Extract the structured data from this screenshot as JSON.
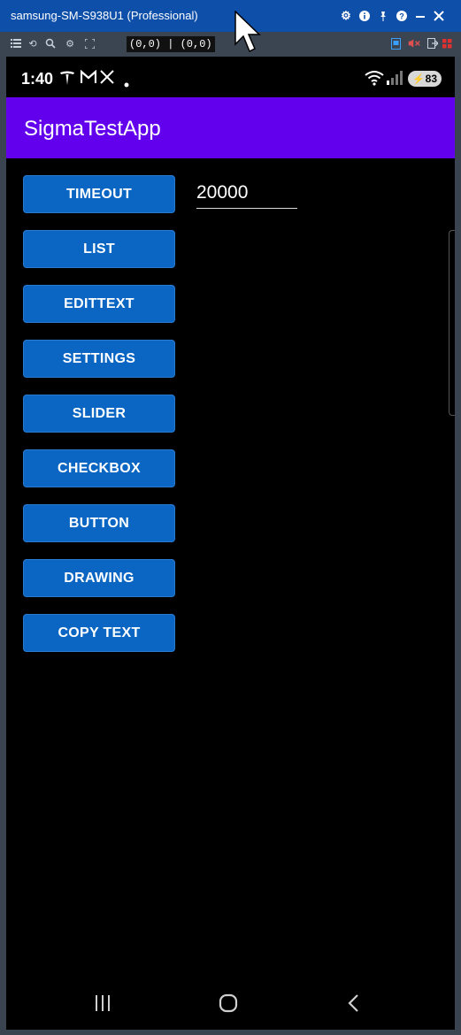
{
  "window": {
    "title": "samsung-SM-S938U1 (Professional)",
    "controls": [
      "gear-icon",
      "info-icon",
      "pin-icon",
      "help-icon",
      "minimize-icon",
      "close-icon"
    ]
  },
  "toolbar": {
    "coords": "(0,0) | (0,0)"
  },
  "status": {
    "time": "1:40",
    "battery": "83"
  },
  "app": {
    "title": "SigmaTestApp",
    "buttons": [
      "TIMEOUT",
      "LIST",
      "EDITTEXT",
      "SETTINGS",
      "SLIDER",
      "CHECKBOX",
      "BUTTON",
      "DRAWING",
      "COPY TEXT"
    ],
    "timeout_value": "20000"
  },
  "colors": {
    "titlebar": "#0e4faa",
    "appbar": "#6200ee",
    "button": "#0a66c2"
  }
}
